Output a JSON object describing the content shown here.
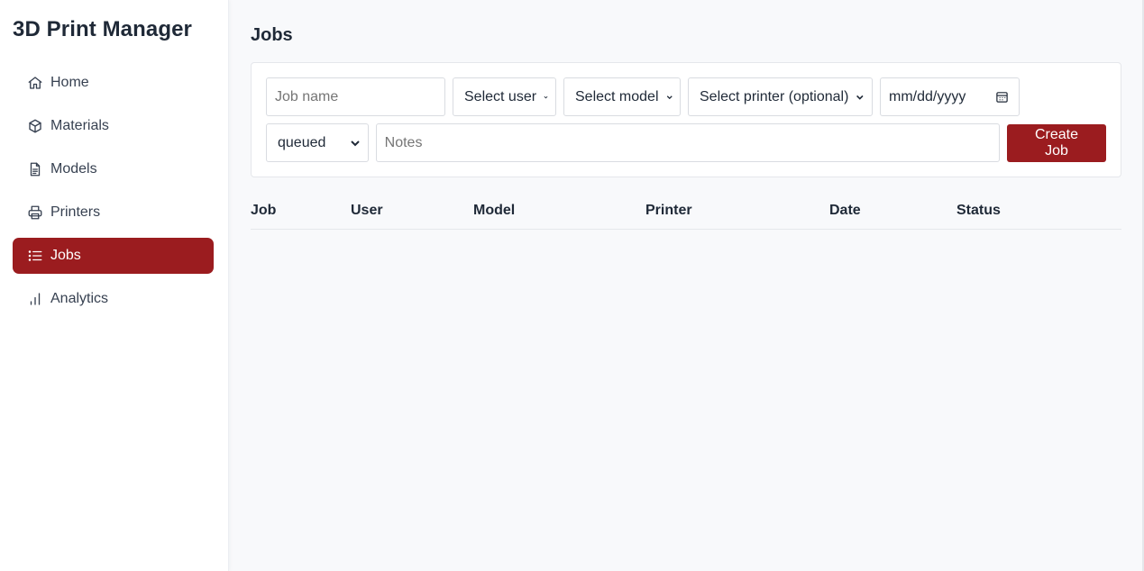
{
  "sidebar": {
    "brand": "3D Print Manager",
    "items": [
      {
        "label": "Home",
        "icon": "home-icon"
      },
      {
        "label": "Materials",
        "icon": "cube-icon"
      },
      {
        "label": "Models",
        "icon": "document-icon"
      },
      {
        "label": "Printers",
        "icon": "printer-icon"
      },
      {
        "label": "Jobs",
        "icon": "list-icon",
        "active": true
      },
      {
        "label": "Analytics",
        "icon": "bar-chart-icon"
      }
    ]
  },
  "main": {
    "title": "Jobs",
    "form": {
      "job_name": {
        "value": "",
        "placeholder": "Job name"
      },
      "user_select": {
        "value": "Select user"
      },
      "model_select": {
        "value": "Select model"
      },
      "printer_select": {
        "value": "Select printer (optional)"
      },
      "date": {
        "value": "mm/dd/yyyy"
      },
      "status_select": {
        "value": "queued"
      },
      "notes": {
        "value": "",
        "placeholder": "Notes"
      },
      "submit_label": "Create Job"
    },
    "table": {
      "columns": [
        "Job",
        "User",
        "Model",
        "Printer",
        "Date",
        "Status"
      ],
      "rows": []
    }
  },
  "colors": {
    "accent": "#9b1c1f",
    "background": "#f8f9fb",
    "sidebar": "#ffffff"
  }
}
